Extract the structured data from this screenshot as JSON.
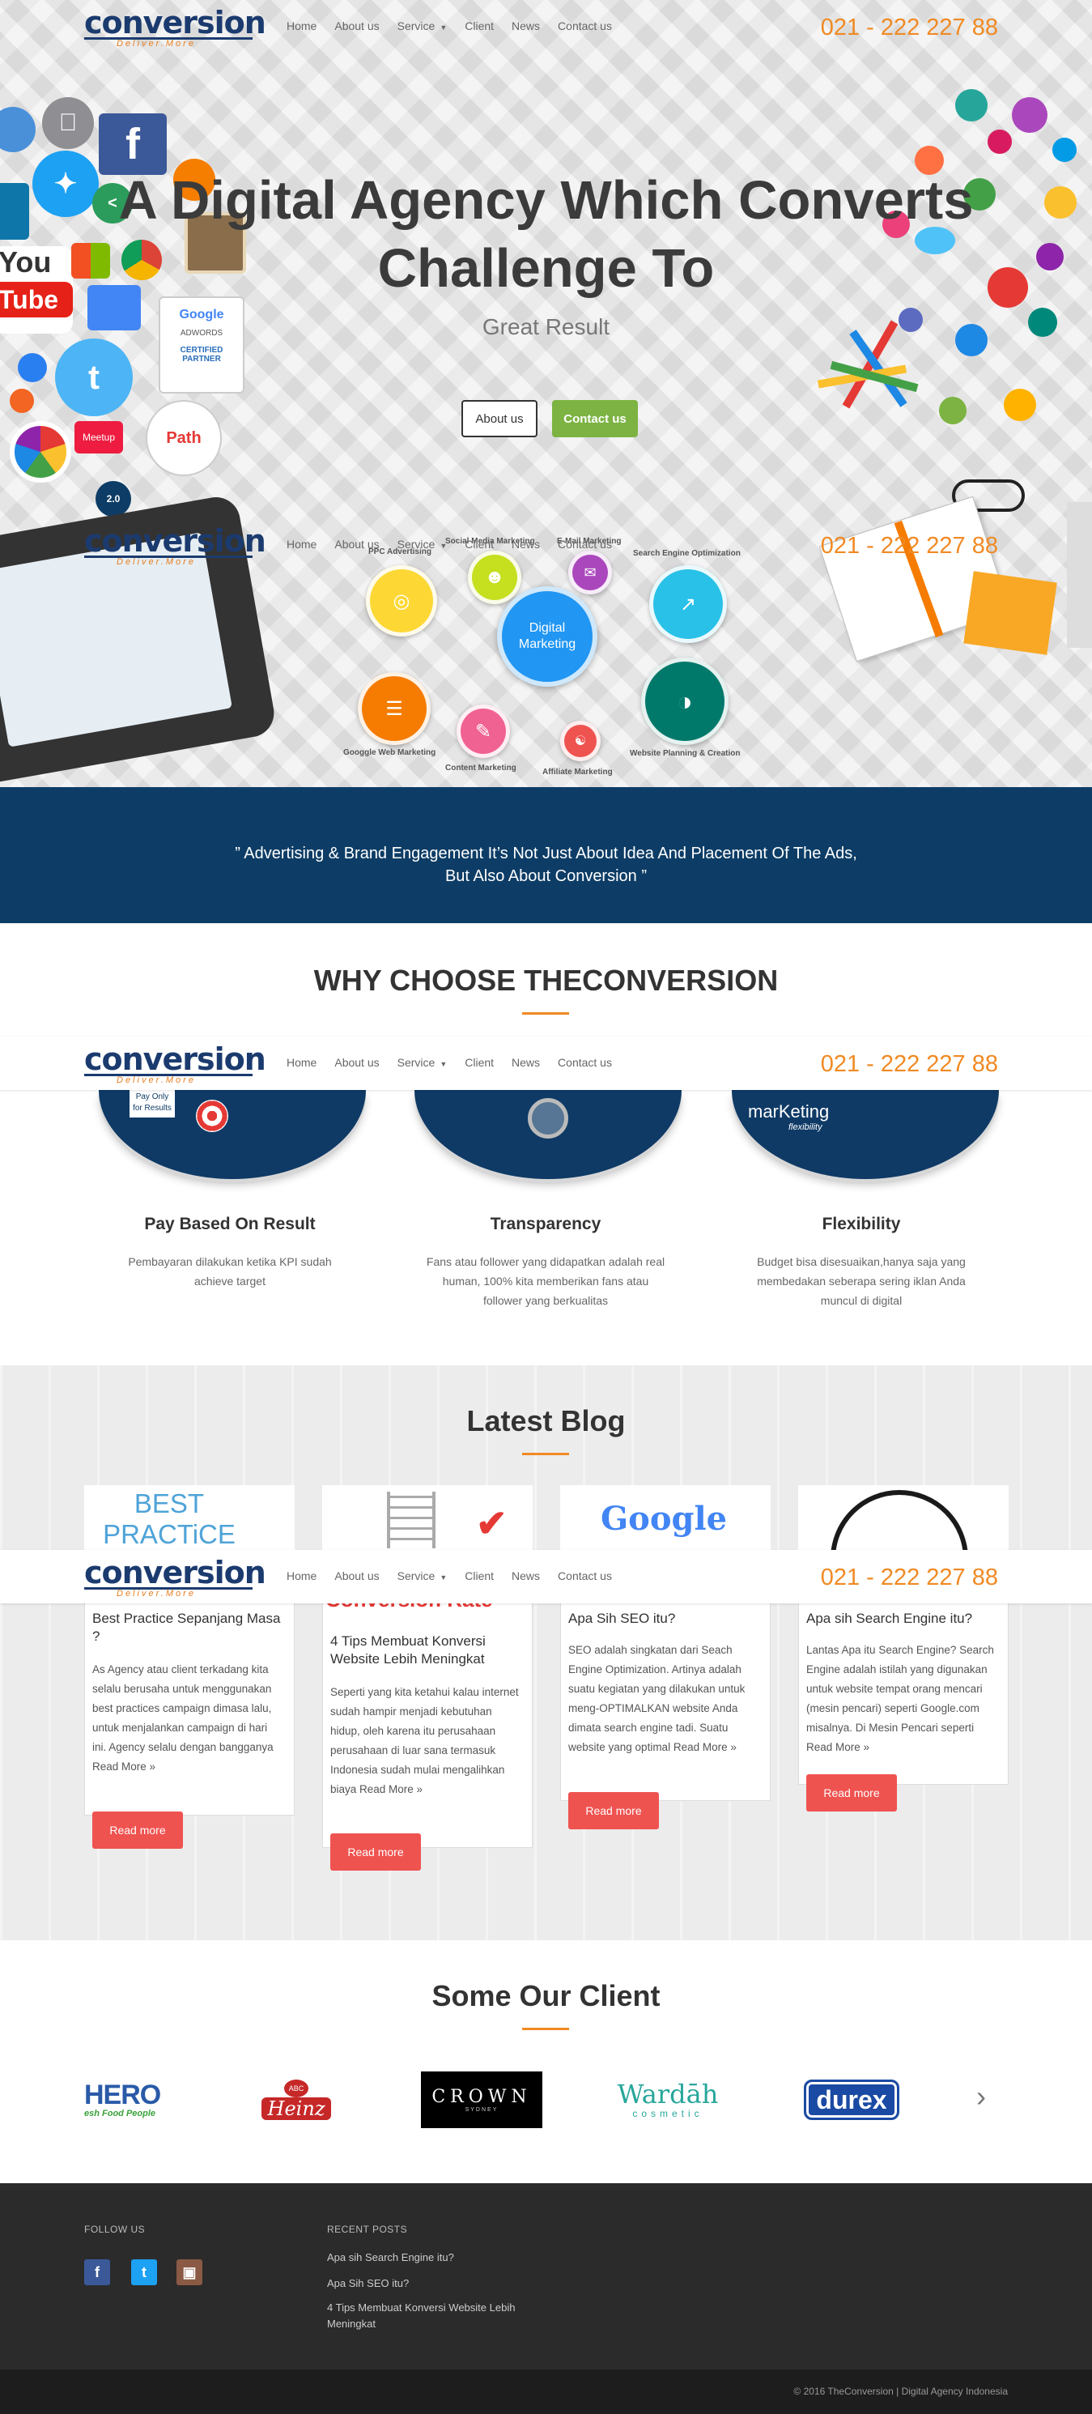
{
  "brand": {
    "logo_word": "conversion",
    "logo_tagline": "Deliver.More",
    "phone": "021 - 222 227 88"
  },
  "nav": {
    "items": [
      "Home",
      "About us",
      "Service",
      "Client",
      "News",
      "Contact us"
    ]
  },
  "hero": {
    "title_line1": "A Digital Agency Which Converts",
    "title_line2": "Challenge To",
    "subtitle": "Great Result",
    "about_btn": "About us",
    "contact_btn": "Contact us",
    "icon_labels": {
      "youtube": "You Tube",
      "google_badge_line1": "Google",
      "google_badge_line2": "ADWORDS",
      "google_badge_line3": "CERTIFIED PARTNER",
      "path": "Path",
      "meetup": "Meetup",
      "web20": "2.0"
    }
  },
  "digital_marketing": {
    "center": "Digital Marketing",
    "labels": {
      "ppc": "PPC Advertising",
      "social": "Social Media Marketing",
      "email": "E-Mail Marketing",
      "seo": "Search Engine Optimization",
      "google_web": "Googgle Web Marketing",
      "content": "Content Marketing",
      "affiliate": "Affiliate Marketing",
      "website": "Website Planning & Creation"
    }
  },
  "quote": {
    "line1": "” Advertising & Brand Engagement It’s Not Just About Idea And Placement Of The Ads,",
    "line2": "But Also About Conversion ”"
  },
  "why": {
    "title": "WHY CHOOSE THECONVERSION",
    "img_labels": {
      "pay_line1": "Pay Only",
      "pay_line2": "for Results",
      "marketing": "marKeting",
      "flexibility": "flexibility"
    },
    "features": [
      {
        "title": "Pay Based On Result",
        "text": "Pembayaran dilakukan ketika KPI sudah achieve target"
      },
      {
        "title": "Transparency",
        "text": "Fans atau follower yang didapatkan adalah real human, 100% kita memberikan fans atau follower yang berkualitas"
      },
      {
        "title": "Flexibility",
        "text": "Budget bisa disesuaikan,hanya saja yang membedakan seberapa sering iklan Anda muncul di digital"
      }
    ]
  },
  "blog": {
    "title": "Latest Blog",
    "read_more_btn": "Read more",
    "thumb_labels": {
      "best_practice": "BEST PRACTiCE",
      "conversion_rate": "Conversion Rate",
      "google": "Google"
    },
    "posts": [
      {
        "title": "Best Practice Sepanjang Masa ?",
        "text": "As Agency atau client terkadang kita selalu berusaha untuk menggunakan best practices campaign dimasa lalu, untuk menjalankan campaign di hari ini. Agency selalu dengan bangganya Read More »"
      },
      {
        "title": "4 Tips Membuat Konversi Website Lebih Meningkat",
        "text": "Seperti yang kita ketahui kalau internet sudah hampir menjadi kebutuhan hidup, oleh karena itu perusahaan perusahaan di luar sana termasuk Indonesia sudah mulai mengalihkan biaya Read More »"
      },
      {
        "title": "Apa Sih SEO itu?",
        "text": "SEO adalah singkatan dari Seach Engine Optimization. Artinya adalah suatu kegiatan yang dilakukan untuk meng-OPTIMALKAN website Anda dimata search engine tadi. Suatu website yang optimal Read More »"
      },
      {
        "title": "Apa sih Search Engine itu?",
        "text": "Lantas Apa itu Search Engine? Search Engine adalah istilah yang digunakan untuk website tempat orang mencari (mesin pencari) seperti Google.com misalnya. Di Mesin Pencari seperti Read More »"
      }
    ]
  },
  "clients": {
    "title": "Some Our Client",
    "logos": {
      "hero": "HERO",
      "hero_tag": "esh Food People",
      "heinz_top": "ABC",
      "heinz": "Heinz",
      "crown": "CROWN",
      "crown_sub": "SYDNEY",
      "wardah": "Wardāh",
      "wardah_sub": "cosmetic",
      "durex": "durex"
    },
    "next_arrow": "›"
  },
  "footer": {
    "follow_heading": "FOLLOW US",
    "recent_heading": "RECENT POSTS",
    "social": {
      "facebook": "f",
      "twitter": "t",
      "instagram": "▣"
    },
    "recent_posts": [
      "Apa sih Search Engine itu?",
      "Apa Sih SEO itu?",
      "4 Tips Membuat Konversi Website Lebih Meningkat"
    ],
    "copyright": "© 2016 TheConversion | Digital Agency Indonesia"
  },
  "colors": {
    "phone_orange": "#f08a24",
    "navy_band": "#0d3d66",
    "contact_green": "#7cb342",
    "read_more_red": "#ef5350",
    "footer_dark": "#2b2b2b"
  }
}
